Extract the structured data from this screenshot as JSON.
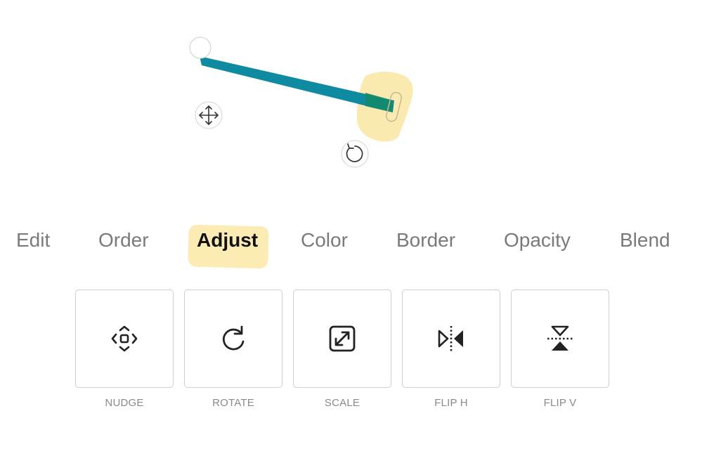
{
  "colors": {
    "line": "#0e8ba0",
    "line_end": "#138a6a",
    "highlight": "#fbe8a6",
    "tab_inactive": "#7a7a7a",
    "tab_active": "#111111",
    "tool_label": "#8a8a8a",
    "tool_border": "#cfcfcf"
  },
  "canvas": {
    "handles": {
      "start": "round-endpoint-handle",
      "end": "pill-resize-handle",
      "move": "move-arrows-icon",
      "rotate": "rotate-icon"
    }
  },
  "tabs": [
    {
      "label": "Edit",
      "active": false
    },
    {
      "label": "Order",
      "active": false
    },
    {
      "label": "Adjust",
      "active": true
    },
    {
      "label": "Color",
      "active": false
    },
    {
      "label": "Border",
      "active": false
    },
    {
      "label": "Opacity",
      "active": false
    },
    {
      "label": "Blend",
      "active": false
    }
  ],
  "tools": [
    {
      "label": "NUDGE",
      "icon": "nudge-icon"
    },
    {
      "label": "ROTATE",
      "icon": "rotate-icon"
    },
    {
      "label": "SCALE",
      "icon": "scale-icon"
    },
    {
      "label": "FLIP H",
      "icon": "flip-horizontal-icon"
    },
    {
      "label": "FLIP V",
      "icon": "flip-vertical-icon"
    }
  ]
}
